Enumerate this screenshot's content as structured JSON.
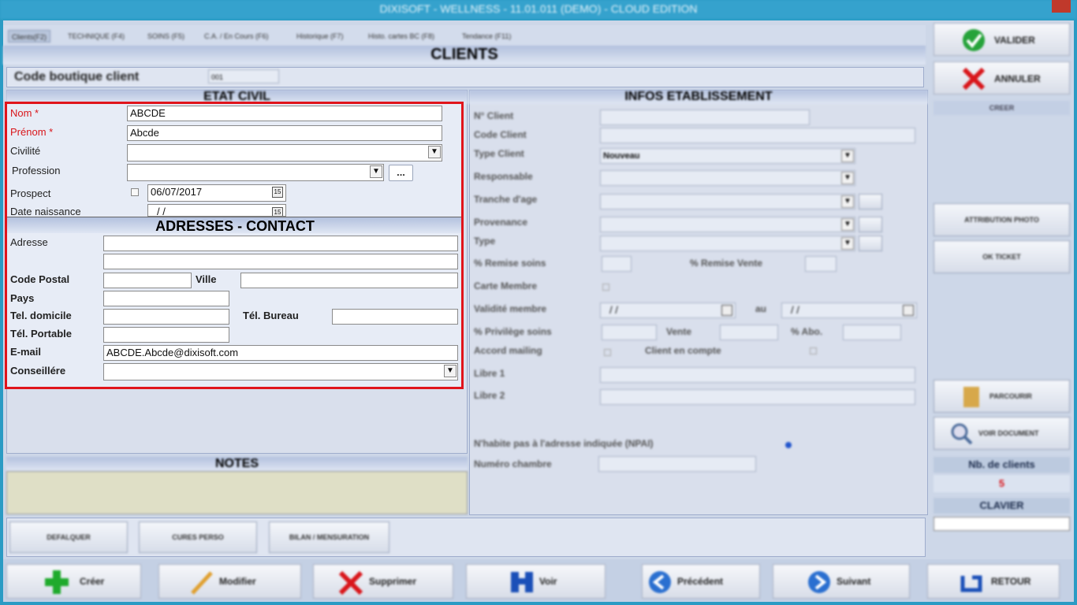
{
  "window": {
    "title": "DIXISOFT - WELLNESS - 11.01.011 (DEMO) - CLOUD EDITION"
  },
  "tabs": [
    {
      "label": "Clients(F2)"
    },
    {
      "label": "TECHNIQUE (F4)"
    },
    {
      "label": "SOINS (F5)"
    },
    {
      "label": "C.A. / En Cours (F6)"
    },
    {
      "label": "Historique (F7)"
    },
    {
      "label": "Histo. cartes BC (F8)"
    },
    {
      "label": "Tendance (F11)"
    }
  ],
  "header": {
    "title": "CLIENTS"
  },
  "boutique": {
    "label": "Code boutique client",
    "value": "001"
  },
  "etat_civil": {
    "title": "ETAT CIVIL",
    "nom_label": "Nom *",
    "nom_value": "ABCDE",
    "prenom_label": "Prénom  *",
    "prenom_value": "Abcde",
    "civilite_label": "Civilité",
    "profession_label": "Profession",
    "profession_button": "...",
    "prospect_label": "Prospect",
    "prospect_date": "06/07/2017",
    "date_naissance_label": "Date naissance",
    "date_naissance_value": "/  /"
  },
  "adresses": {
    "title": "ADRESSES - CONTACT",
    "adresse_label": "Adresse",
    "code_postal_label": "Code Postal",
    "ville_label": "Ville",
    "pays_label": "Pays",
    "tel_domicile_label": "Tel. domicile",
    "tel_bureau_label": "Tél. Bureau",
    "tel_portable_label": "Tél. Portable",
    "email_label": "E-mail",
    "email_value": "ABCDE.Abcde@dixisoft.com",
    "conseillere_label": "Conseillére"
  },
  "notes": {
    "title": "NOTES"
  },
  "infos": {
    "title": "INFOS ETABLISSEMENT",
    "n_client": "N° Client",
    "code_client": "Code Client",
    "type_client": "Type Client",
    "type_client_value": "Nouveau",
    "responsable": "Responsable",
    "tranche_age": "Tranche d'age",
    "provenance": "Provenance",
    "type": "Type",
    "remise_soins": "% Remise soins",
    "remise_vente": "% Remise  Vente",
    "carte_membre": "Carte Membre",
    "validite_membre": "Validité membre",
    "validite_from": "/  /",
    "au": "au",
    "validite_to": "/  /",
    "privilege_soins": "% Privilège soins",
    "vente": "Vente",
    "abo": "% Abo.",
    "accord_mailing": "Accord mailing",
    "client_en_compte": "Client en compte",
    "libre1": "Libre 1",
    "libre2": "Libre 2",
    "npai": "N'habite pas à l'adresse indiquée (NPAI)",
    "numero_chambre": "Numéro chambre"
  },
  "bottom_buttons": [
    {
      "label": "DEFALQUER"
    },
    {
      "label": "CURES PERSO"
    },
    {
      "label": "BILAN / MENSURATION"
    }
  ],
  "right_panel": {
    "valider": "VALIDER",
    "annuler": "ANNULER",
    "creer": "CREER",
    "attribution_photo": "ATTRIBUTION PHOTO",
    "ok_ticket": "OK TICKET",
    "parcourir": "PARCOURIR",
    "voir_document": "VOIR DOCUMENT",
    "nb_clients_label": "Nb. de clients",
    "nb_clients_value": "5",
    "clavier": "CLAVIER"
  },
  "toolbar": [
    {
      "label": "Créer",
      "icon": "plus-icon",
      "color": "#1faa2c"
    },
    {
      "label": "Modifier",
      "icon": "pencil-icon",
      "color": "#e0a030"
    },
    {
      "label": "Supprimer",
      "icon": "x-icon",
      "color": "#d9161b"
    },
    {
      "label": "Voir",
      "icon": "binoculars-icon",
      "color": "#1a4fb8"
    },
    {
      "label": "Précédent",
      "icon": "arrow-left-icon",
      "color": "#2a6fd0"
    },
    {
      "label": "Suivant",
      "icon": "arrow-right-icon",
      "color": "#2a6fd0"
    },
    {
      "label": "RETOUR",
      "icon": "return-icon",
      "color": "#1a4fb8"
    }
  ]
}
